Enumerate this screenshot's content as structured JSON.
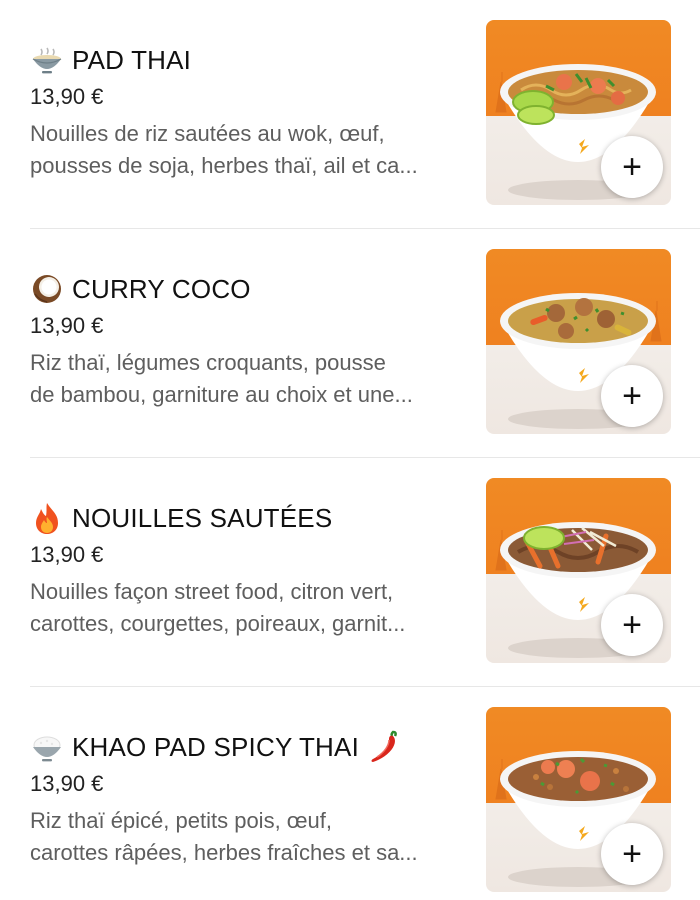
{
  "items": [
    {
      "icon": "noodle-bowl-icon",
      "title": "PAD THAI",
      "price": "13,90 €",
      "description": "Nouilles de riz sautées au wok, œuf,\npousses de soja, herbes thaï, ail et ca...",
      "add_label": "+"
    },
    {
      "icon": "coconut-icon",
      "title": "CURRY COCO",
      "price": "13,90 €",
      "description": "Riz thaï, légumes croquants, pousse\nde bambou, garniture au choix et une...",
      "add_label": "+"
    },
    {
      "icon": "fire-icon",
      "title": "NOUILLES SAUTÉES",
      "price": "13,90 €",
      "description": "Nouilles façon street food, citron vert,\ncarottes, courgettes, poireaux, garnit...",
      "add_label": "+"
    },
    {
      "icon": "rice-bowl-icon",
      "trailing_icon": "chili-pepper-icon",
      "title": "KHAO PAD SPICY THAI",
      "price": "13,90 €",
      "description": "Riz thaï épicé, petits pois, œuf,\ncarottes râpées, herbes fraîches et sa...",
      "add_label": "+"
    }
  ],
  "colors": {
    "thumb_orange": "#f08a24",
    "text_primary": "#111111",
    "text_secondary": "#5e5e5e",
    "divider": "#e7e7e7"
  }
}
